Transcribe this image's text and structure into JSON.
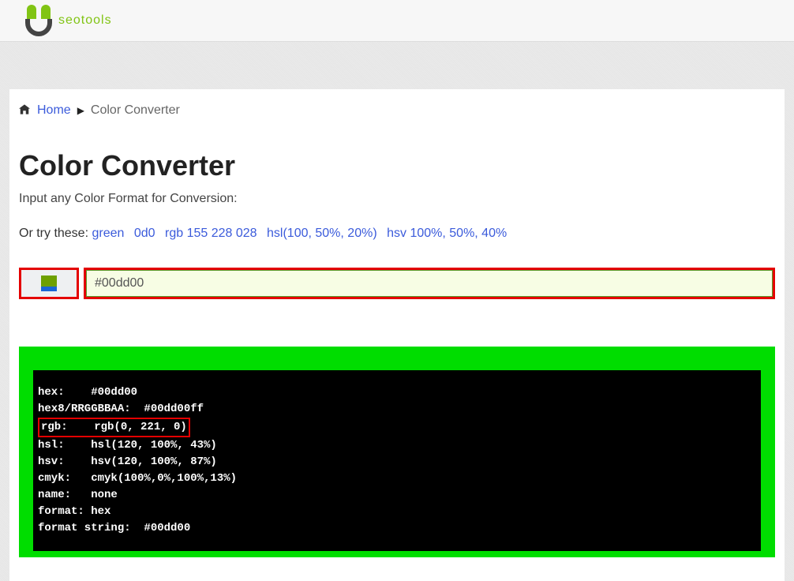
{
  "logo": {
    "text": "seotools"
  },
  "breadcrumb": {
    "home": "Home",
    "current": "Color Converter"
  },
  "page": {
    "title": "Color Converter",
    "subtitle": "Input any Color Format for Conversion:"
  },
  "examples": {
    "label": "Or try these:",
    "items": [
      "green",
      "0d0",
      "rgb 155 228 028",
      "hsl(100, 50%, 20%)",
      "hsv 100%, 50%, 40%"
    ]
  },
  "input": {
    "value": "#00dd00"
  },
  "result": {
    "bg_color": "#00dd00",
    "lines": {
      "hex": "hex:    #00dd00",
      "hex8": "hex8/RRGGBBAA:  #00dd00ff",
      "rgb": "rgb:    rgb(0, 221, 0)",
      "hsl": "hsl:    hsl(120, 100%, 43%)",
      "hsv": "hsv:    hsv(120, 100%, 87%)",
      "cmyk": "cmyk:   cmyk(100%,0%,100%,13%)",
      "name": "name:   none",
      "format": "format: hex",
      "fmtstr": "format string:  #00dd00"
    }
  }
}
